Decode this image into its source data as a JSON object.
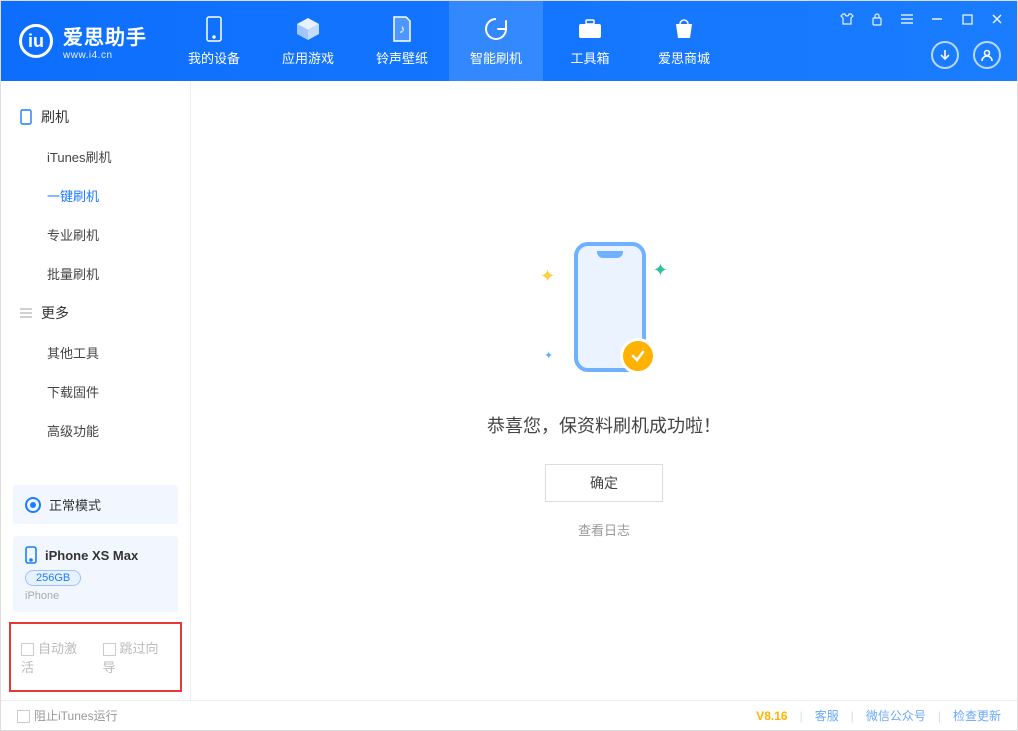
{
  "app": {
    "name": "爱思助手",
    "url": "www.i4.cn"
  },
  "tabs": [
    {
      "label": "我的设备"
    },
    {
      "label": "应用游戏"
    },
    {
      "label": "铃声壁纸"
    },
    {
      "label": "智能刷机"
    },
    {
      "label": "工具箱"
    },
    {
      "label": "爱思商城"
    }
  ],
  "sidebar": {
    "group1": {
      "title": "刷机",
      "items": [
        "iTunes刷机",
        "一键刷机",
        "专业刷机",
        "批量刷机"
      ]
    },
    "group2": {
      "title": "更多",
      "items": [
        "其他工具",
        "下载固件",
        "高级功能"
      ]
    }
  },
  "mode_label": "正常模式",
  "device": {
    "name": "iPhone XS Max",
    "storage": "256GB",
    "type": "iPhone"
  },
  "bottom_checks": {
    "auto_activate": "自动激活",
    "skip_guide": "跳过向导"
  },
  "main": {
    "success": "恭喜您，保资料刷机成功啦！",
    "ok": "确定",
    "view_log": "查看日志"
  },
  "footer": {
    "block_itunes": "阻止iTunes运行",
    "version": "V8.16",
    "support": "客服",
    "wechat": "微信公众号",
    "check_update": "检查更新"
  }
}
